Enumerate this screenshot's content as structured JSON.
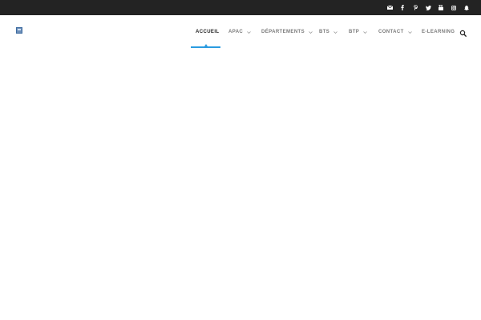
{
  "topbar": {
    "social": [
      "envelope-icon",
      "facebook-icon",
      "pinterest-icon",
      "twitter-icon",
      "youtube-icon",
      "instagram-icon",
      "snapchat-icon"
    ]
  },
  "nav": {
    "items": [
      {
        "label": "ACCUEIL",
        "active": true,
        "dropdown": false
      },
      {
        "label": "APAC",
        "active": false,
        "dropdown": true
      },
      {
        "label": "DÉPARTEMENTS",
        "active": false,
        "dropdown": true
      },
      {
        "label": "BTS",
        "active": false,
        "dropdown": true
      },
      {
        "label": "BTP",
        "active": false,
        "dropdown": true
      },
      {
        "label": "CONTACT",
        "active": false,
        "dropdown": true
      },
      {
        "label": "E-LEARNING",
        "active": false,
        "dropdown": false
      }
    ]
  },
  "colors": {
    "topbar": "#232323",
    "accent": "#2b9be0",
    "nav_text": "#7a7a7a",
    "nav_active_text": "#222222"
  }
}
